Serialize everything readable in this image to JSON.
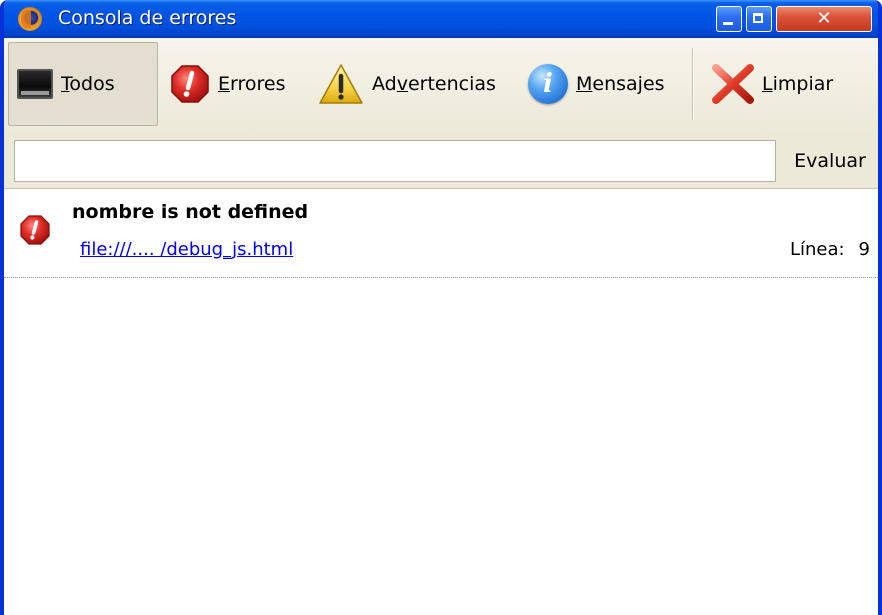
{
  "window": {
    "title": "Consola de errores",
    "close_glyph": "✕"
  },
  "toolbar": {
    "todos": {
      "accel": "T",
      "rest": "odos",
      "icon": "monitor-icon"
    },
    "errores": {
      "accel": "E",
      "rest": "rrores",
      "icon": "error-icon"
    },
    "advertencias": {
      "pre": "Ad",
      "accel": "v",
      "rest": "ertencias",
      "icon": "warning-icon"
    },
    "mensajes": {
      "accel": "M",
      "rest": "ensajes",
      "icon": "info-icon",
      "glyph": "i"
    },
    "limpiar": {
      "accel": "L",
      "rest": "impiar",
      "icon": "clear-icon"
    }
  },
  "eval": {
    "value": "",
    "placeholder": "",
    "button_label": "Evaluar"
  },
  "messages": [
    {
      "type": "error",
      "text": "nombre is not defined",
      "source": "file:///.... /debug_js.html",
      "line_label": "Línea:",
      "line_number": "9"
    }
  ],
  "colors": {
    "titlebar": "#0054e3",
    "toolbar_bg": "#ece9d8",
    "link": "#0000ee",
    "error_red": "#d9251e",
    "warning_yellow": "#f7d44a",
    "info_blue": "#1f6fd3"
  }
}
